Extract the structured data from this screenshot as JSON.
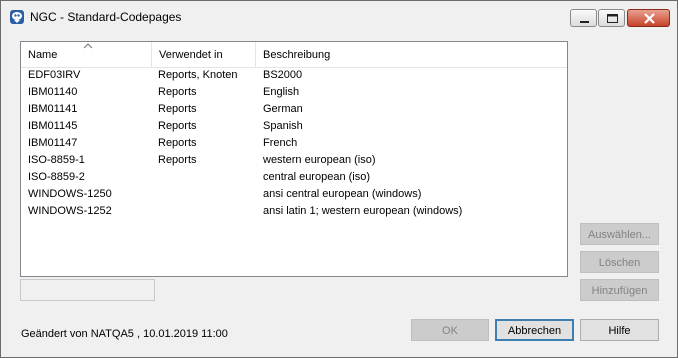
{
  "window": {
    "title": "NGC - Standard-Codepages"
  },
  "table": {
    "columns": [
      "Name",
      "Verwendet in",
      "Beschreibung"
    ],
    "rows": [
      {
        "name": "EDF03IRV",
        "used_in": "Reports, Knoten",
        "description": "BS2000"
      },
      {
        "name": "IBM01140",
        "used_in": "Reports",
        "description": "English"
      },
      {
        "name": "IBM01141",
        "used_in": "Reports",
        "description": "German"
      },
      {
        "name": "IBM01145",
        "used_in": "Reports",
        "description": "Spanish"
      },
      {
        "name": "IBM01147",
        "used_in": "Reports",
        "description": "French"
      },
      {
        "name": "ISO-8859-1",
        "used_in": "Reports",
        "description": "western european (iso)"
      },
      {
        "name": "ISO-8859-2",
        "used_in": "",
        "description": "central european (iso)"
      },
      {
        "name": "WINDOWS-1250",
        "used_in": "",
        "description": "ansi central european (windows)"
      },
      {
        "name": "WINDOWS-1252",
        "used_in": "",
        "description": "ansi latin 1; western european (windows)"
      }
    ]
  },
  "buttons": {
    "select": "Auswählen...",
    "delete": "Löschen",
    "add": "Hinzufügen",
    "ok": "OK",
    "cancel": "Abbrechen",
    "help": "Hilfe"
  },
  "status": {
    "changed_by": "Geändert von NATQA5 , 10.01.2019 11:00"
  }
}
